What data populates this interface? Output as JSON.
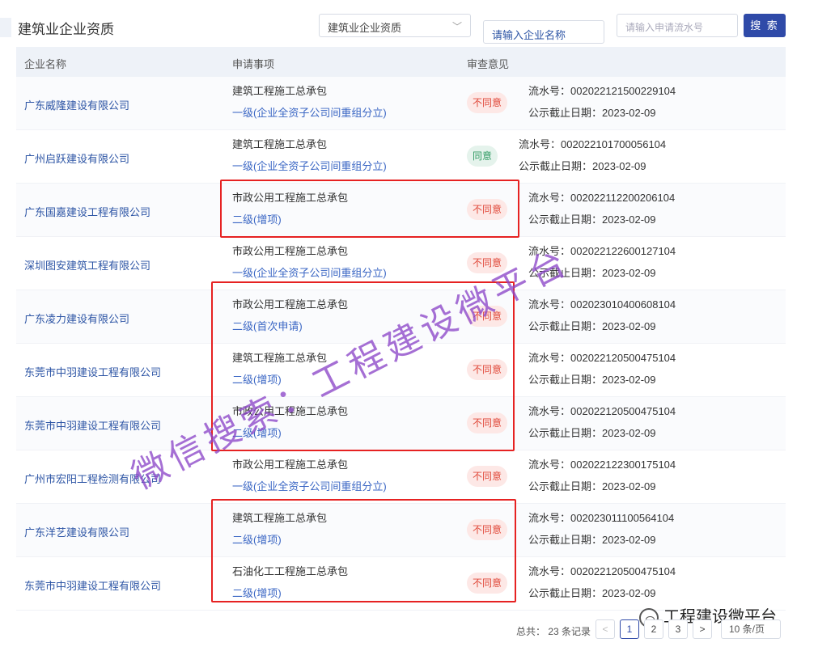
{
  "header": {
    "title": "建筑业企业资质",
    "category_select": "建筑业企业资质",
    "company_placeholder": "请输入企业名称",
    "serial_placeholder": "请输入申请流水号",
    "search_label": "搜 索"
  },
  "table": {
    "columns": [
      "企业名称",
      "申请事项",
      "审查意见"
    ],
    "rows": [
      {
        "company": "广东威隆建设有限公司",
        "item": "建筑工程施工总承包",
        "level": "一级(企业全资子公司间重组分立)",
        "opinion": "不同意",
        "serial": "流水号：002022121500229104",
        "date": "公示截止日期：2023-02-09"
      },
      {
        "company": "广州启跃建设有限公司",
        "item": "建筑工程施工总承包",
        "level": "一级(企业全资子公司间重组分立)",
        "opinion": "同意",
        "serial": "流水号：002022101700056104",
        "date": "公示截止日期：2023-02-09"
      },
      {
        "company": "广东国嘉建设工程有限公司",
        "item": "市政公用工程施工总承包",
        "level": "二级(增项)",
        "opinion": "不同意",
        "serial": "流水号：002022112200206104",
        "date": "公示截止日期：2023-02-09"
      },
      {
        "company": "深圳图安建筑工程有限公司",
        "item": "市政公用工程施工总承包",
        "level": "一级(企业全资子公司间重组分立)",
        "opinion": "不同意",
        "serial": "流水号：002022122600127104",
        "date": "公示截止日期：2023-02-09"
      },
      {
        "company": "广东凌力建设有限公司",
        "item": "市政公用工程施工总承包",
        "level": "二级(首次申请)",
        "opinion": "不同意",
        "serial": "流水号：002023010400608104",
        "date": "公示截止日期：2023-02-09"
      },
      {
        "company": "东莞市中羽建设工程有限公司",
        "item": "建筑工程施工总承包",
        "level": "二级(增项)",
        "opinion": "不同意",
        "serial": "流水号：002022120500475104",
        "date": "公示截止日期：2023-02-09"
      },
      {
        "company": "东莞市中羽建设工程有限公司",
        "item": "市政公用工程施工总承包",
        "level": "二级(增项)",
        "opinion": "不同意",
        "serial": "流水号：002022120500475104",
        "date": "公示截止日期：2023-02-09"
      },
      {
        "company": "广州市宏阳工程检测有限公司",
        "item": "市政公用工程施工总承包",
        "level": "一级(企业全资子公司间重组分立)",
        "opinion": "不同意",
        "serial": "流水号：002022122300175104",
        "date": "公示截止日期：2023-02-09"
      },
      {
        "company": "广东洋艺建设有限公司",
        "item": "建筑工程施工总承包",
        "level": "二级(增项)",
        "opinion": "不同意",
        "serial": "流水号：002023011100564104",
        "date": "公示截止日期：2023-02-09"
      },
      {
        "company": "东莞市中羽建设工程有限公司",
        "item": "石油化工工程施工总承包",
        "level": "二级(增项)",
        "opinion": "不同意",
        "serial": "流水号：002022120500475104",
        "date": "公示截止日期：2023-02-09"
      }
    ]
  },
  "pagination": {
    "total": "总共： 23 条记录",
    "prev": "<",
    "pages": [
      "1",
      "2",
      "3"
    ],
    "next": ">",
    "page_size": "10 条/页"
  },
  "watermark": "微信搜索：工程建设微平台",
  "brand": "工程建设微平台",
  "colors": {
    "primary": "#2f4aa8",
    "reject": "#e0493a",
    "agree": "#2f9a62",
    "highlight_box": "#e62222",
    "watermark": "#8c46c8"
  }
}
